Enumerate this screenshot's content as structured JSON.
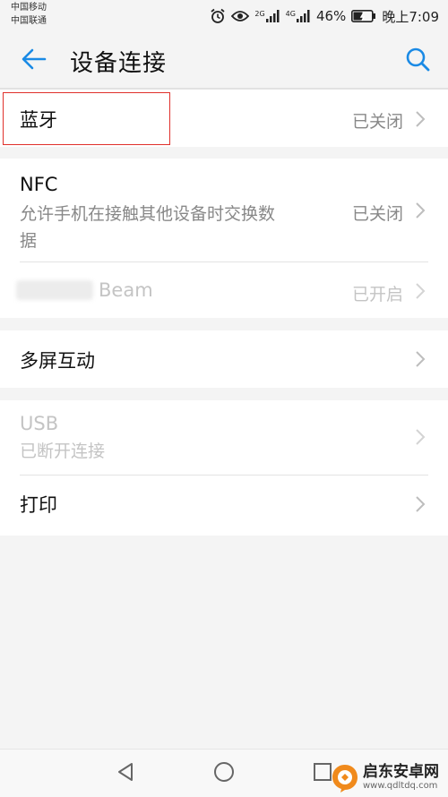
{
  "status_bar": {
    "carrier_1": "中国移动",
    "carrier_2": "中国联通",
    "sig1_label": "2G",
    "sig2_label": "4G",
    "battery": "46%",
    "time": "晚上7:09"
  },
  "header": {
    "title": "设备连接",
    "back_icon": "arrow-left-icon",
    "search_icon": "search-icon",
    "accent": "#1a8ae5"
  },
  "rows": {
    "bluetooth": {
      "title": "蓝牙",
      "value": "已关闭"
    },
    "nfc": {
      "title": "NFC",
      "subtitle": "允许手机在接触其他设备时交换数据",
      "value": "已关闭"
    },
    "beam": {
      "title": "Beam",
      "value": "已开启",
      "state": "disabled"
    },
    "multiscreen": {
      "title": "多屏互动"
    },
    "usb": {
      "title": "USB",
      "subtitle": "已断开连接",
      "state": "disabled"
    },
    "print": {
      "title": "打印"
    }
  },
  "highlight_color": "#e0302b",
  "navbar": {
    "icons": [
      "back-triangle-icon",
      "home-circle-icon",
      "recents-square-icon"
    ]
  },
  "watermark": {
    "main": "启东安卓网",
    "sub": "www.qdltdq.com"
  }
}
